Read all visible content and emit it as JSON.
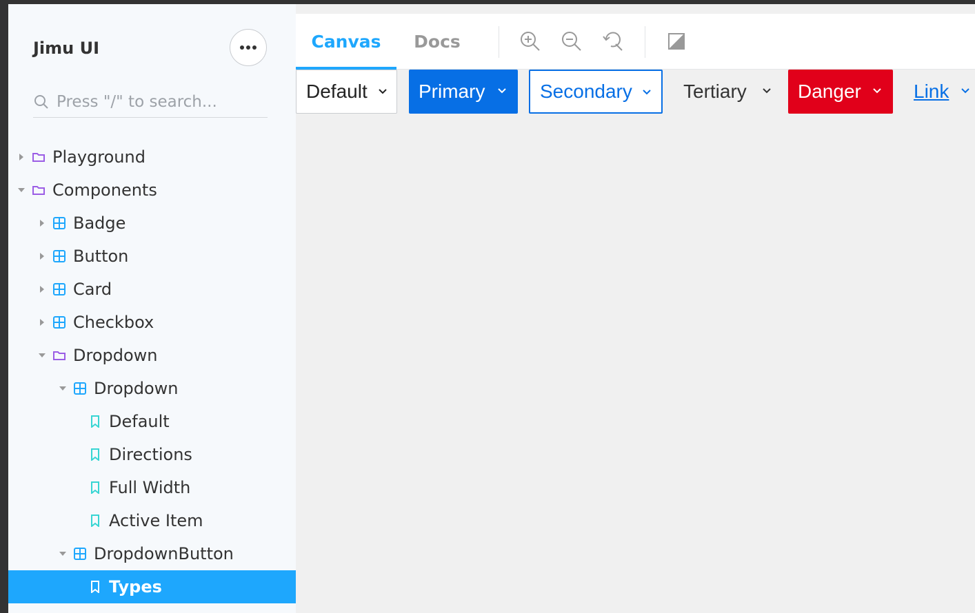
{
  "sidebar": {
    "brand": "Jimu UI",
    "search_placeholder": "Press \"/\" to search...",
    "items": [
      {
        "label": "Playground",
        "expanded": false,
        "icon": "folder-icon"
      },
      {
        "label": "Components",
        "expanded": true,
        "icon": "folder-icon"
      },
      {
        "label": "Badge",
        "expanded": false,
        "icon": "component-icon"
      },
      {
        "label": "Button",
        "expanded": false,
        "icon": "component-icon"
      },
      {
        "label": "Card",
        "expanded": false,
        "icon": "component-icon"
      },
      {
        "label": "Checkbox",
        "expanded": false,
        "icon": "component-icon"
      },
      {
        "label": "Dropdown",
        "expanded": true,
        "icon": "folder-icon"
      },
      {
        "label": "Dropdown",
        "expanded": true,
        "icon": "component-icon"
      },
      {
        "label": "Default",
        "icon": "bookmark-icon"
      },
      {
        "label": "Directions",
        "icon": "bookmark-icon"
      },
      {
        "label": "Full Width",
        "icon": "bookmark-icon"
      },
      {
        "label": "Active Item",
        "icon": "bookmark-icon"
      },
      {
        "label": "DropdownButton",
        "expanded": true,
        "icon": "component-icon"
      },
      {
        "label": "Types",
        "icon": "bookmark-icon",
        "selected": true
      }
    ]
  },
  "toolbar": {
    "tabs": [
      {
        "label": "Canvas",
        "active": true
      },
      {
        "label": "Docs",
        "active": false
      }
    ],
    "tools": [
      "zoom-in-icon",
      "zoom-out-icon",
      "reset-zoom-icon",
      "background-toggle-icon"
    ]
  },
  "canvas": {
    "buttons": [
      {
        "label": "Default",
        "type": "default"
      },
      {
        "label": "Primary",
        "type": "primary"
      },
      {
        "label": "Secondary",
        "type": "secondary"
      },
      {
        "label": "Tertiary",
        "type": "tertiary"
      },
      {
        "label": "Danger",
        "type": "danger"
      },
      {
        "label": "Link",
        "type": "link"
      }
    ]
  },
  "colors": {
    "accent": "#1ea7fd",
    "primary": "#076fe5",
    "danger": "#e1001a",
    "folder": "#9b5de5",
    "component": "#1ea7fd",
    "story": "#37d5d3"
  }
}
